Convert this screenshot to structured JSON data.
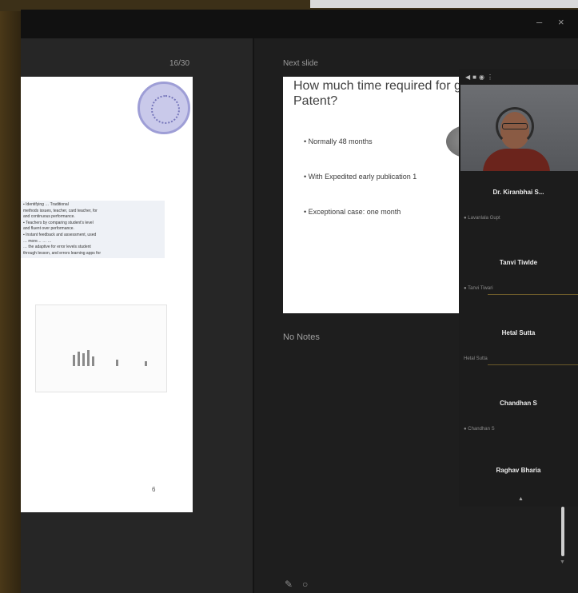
{
  "window": {
    "controls": [
      "–",
      "×"
    ]
  },
  "left_pane": {
    "label": "16/30",
    "thumbnail": {
      "text_lines": [
        "▪ Identifying … Traditional",
        "methods issues, teacher, card teacher, for",
        "and continuous performance.",
        "▪ Teachers by comparing student's level",
        "and fluent over performance.",
        "▪ Instant feedback and assessment, used",
        "… more… … …",
        "… the adaptive for error levels student",
        "through lesson, and errors learning apps for"
      ],
      "page_marker": "6"
    }
  },
  "right_pane": {
    "label": "Next slide",
    "slide": {
      "title_line1": "How much time required for g",
      "title_line2": "Patent?",
      "bullets": [
        "• Normally 48 months",
        "• With Expedited early publication 1",
        "• Exceptional case: one month"
      ]
    },
    "notes_label": "No Notes",
    "bottom_icons": [
      "pen-icon",
      "laser-icon"
    ]
  },
  "participants": {
    "toolbar_icons": [
      "chevron-left-icon",
      "grid-icon",
      "view-icon",
      "more-icon"
    ],
    "items": [
      {
        "name": "Dr. Kiranbhai S...",
        "sub": "● Lavanlala Gupt"
      },
      {
        "name": "Tanvi Tiwlde",
        "sub": "● Tanvi Tiwari"
      },
      {
        "name": "Hetal Sutta",
        "sub": "Hetal Sutta"
      },
      {
        "name": "Chandhan S",
        "sub": "● Chandhan S"
      },
      {
        "name": "Raghav Bharia",
        "sub": ""
      }
    ],
    "scroll_hint": "▲"
  },
  "colors": {
    "window_bg": "#222222",
    "slide_bg": "#ffffff",
    "seal": "#9e9ed6",
    "avatar_shirt": "#6b241c"
  }
}
